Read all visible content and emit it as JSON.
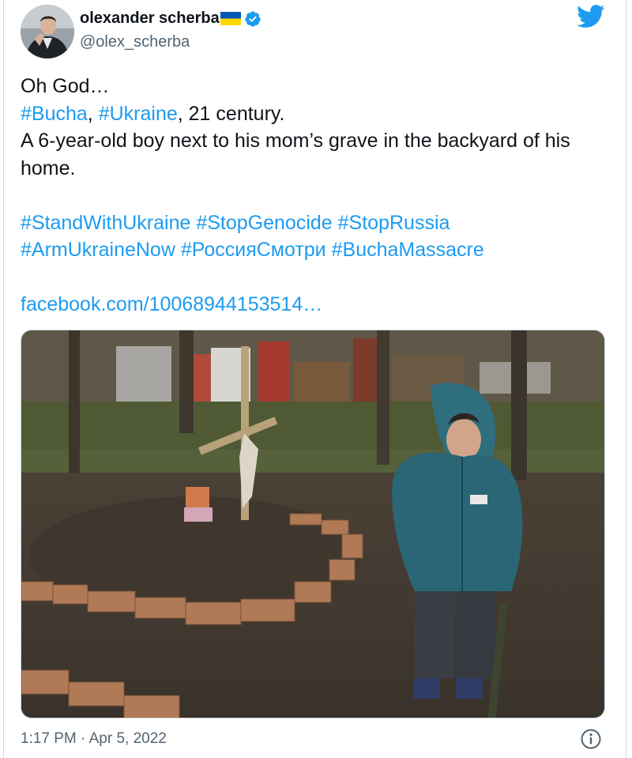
{
  "author": {
    "name": "olexander scherba",
    "handle": "@olex_scherba"
  },
  "tweet": {
    "line1": "Oh God…",
    "tag_bucha": "#Bucha",
    "comma1": ",",
    "tag_ukraine": "#Ukraine",
    "line2_rest": ", 21 century.",
    "line3": "A 6-year-old boy next to his mom’s grave in the backyard of his home.",
    "hashtags_row1": [
      "#StandWithUkraine",
      "#StopGenocide",
      "#StopRussia"
    ],
    "hashtags_row2": [
      "#ArmUkraineNow",
      "#РоссияСмотри",
      "#BuchaMassacre"
    ],
    "link": "facebook.com/10068944153514…"
  },
  "timestamp": "1:17 PM · Apr 5, 2022",
  "icons": {
    "brand": "twitter-bird-icon",
    "verified": "verified-badge-icon",
    "flag": "ukraine-flag-icon",
    "info": "info-icon"
  },
  "colors": {
    "link": "#1d9bf0",
    "brand": "#1d9bf0",
    "text": "#0f1419",
    "secondary": "#536471",
    "flag_blue": "#0057b7",
    "flag_yellow": "#ffd700"
  }
}
